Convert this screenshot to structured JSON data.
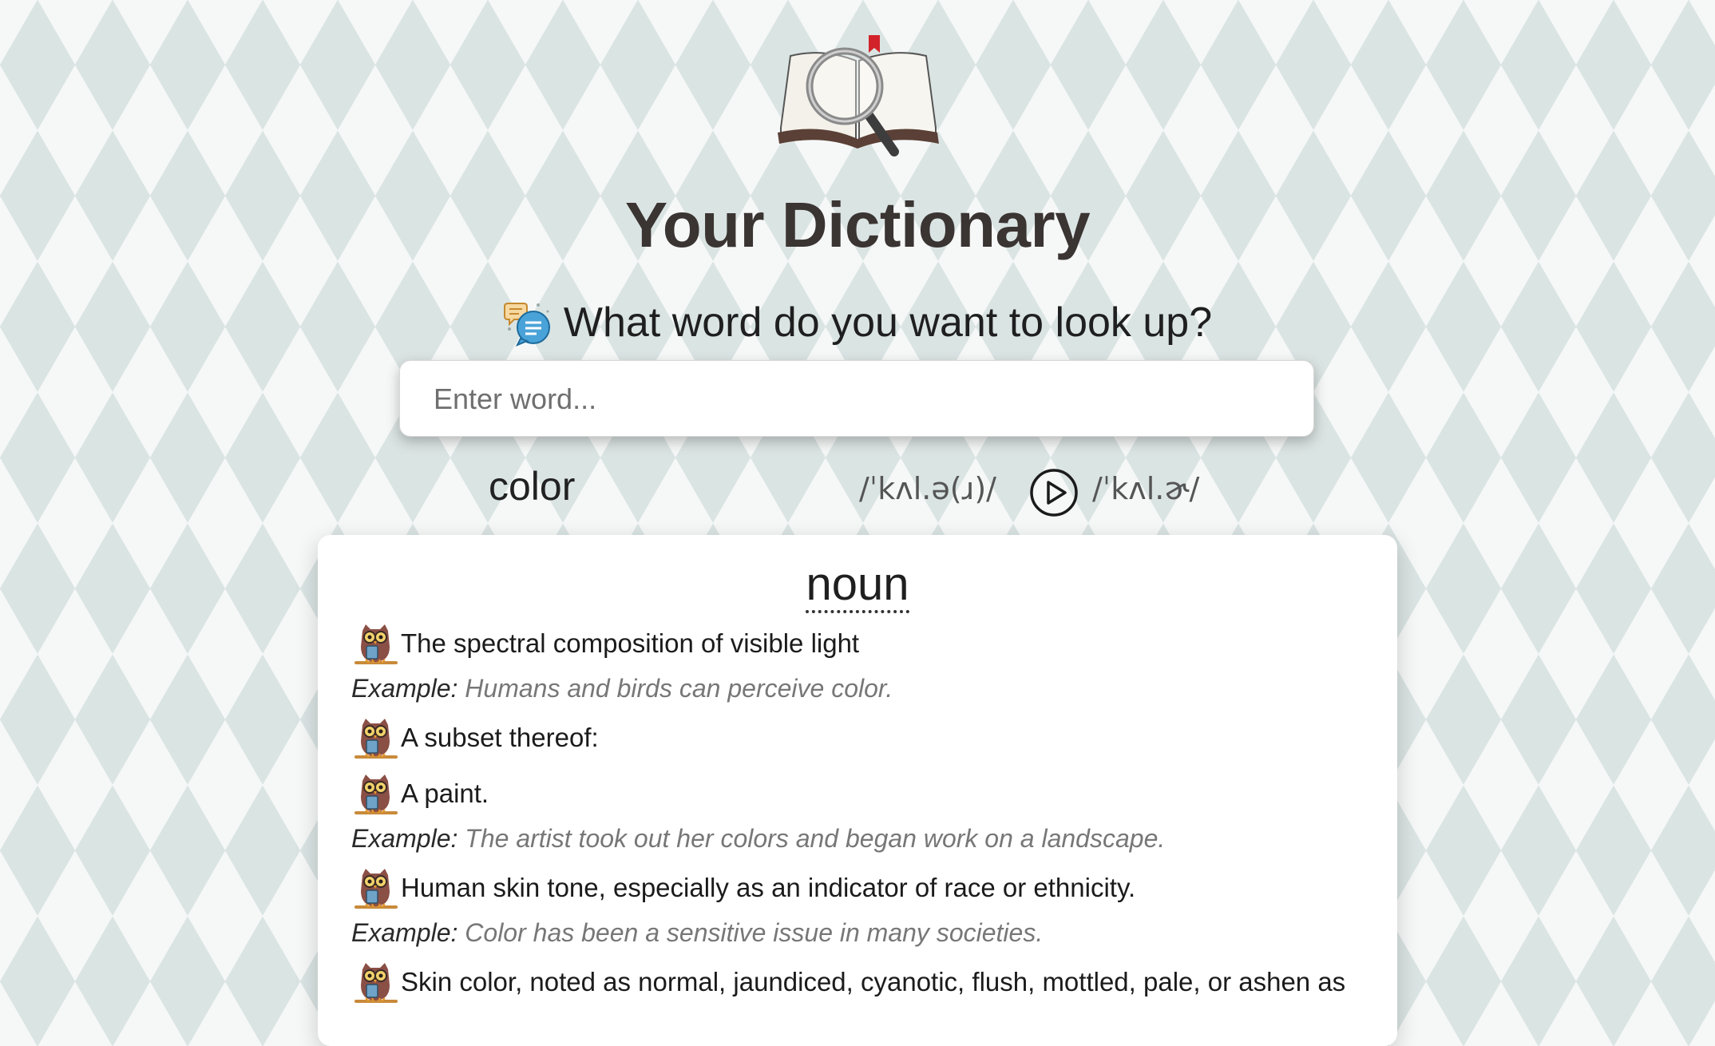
{
  "app": {
    "logo_icon": "book-with-magnifier-icon",
    "title": "Your Dictionary",
    "prompt_icon": "speech-bubbles-icon",
    "prompt": "What word do you want to look up?"
  },
  "search": {
    "placeholder": "Enter word...",
    "value": ""
  },
  "result": {
    "word": "color",
    "phonetic_uk": "/ˈkʌl.ə(ɹ)/",
    "play_icon": "play-circle-icon",
    "phonetic_us": "/ˈkʌl.ɚ/",
    "part_of_speech": "noun",
    "example_label": "Example:",
    "bullet_icon": "owl-icon",
    "definitions": [
      {
        "text": "The spectral composition of visible light",
        "example": "Humans and birds can perceive color."
      },
      {
        "text": "A subset thereof:",
        "example": ""
      },
      {
        "text": "A paint.",
        "example": "The artist took out her colors and began work on a landscape."
      },
      {
        "text": "Human skin tone, especially as an indicator of race or ethnicity.",
        "example": "Color has been a sensitive issue in many societies."
      },
      {
        "text": "Skin color, noted as normal, jaundiced, cyanotic, flush, mottled, pale, or ashen as",
        "example": ""
      }
    ]
  },
  "colors": {
    "title": "#3a3432",
    "example_text": "#777777",
    "card": "#ffffff"
  }
}
